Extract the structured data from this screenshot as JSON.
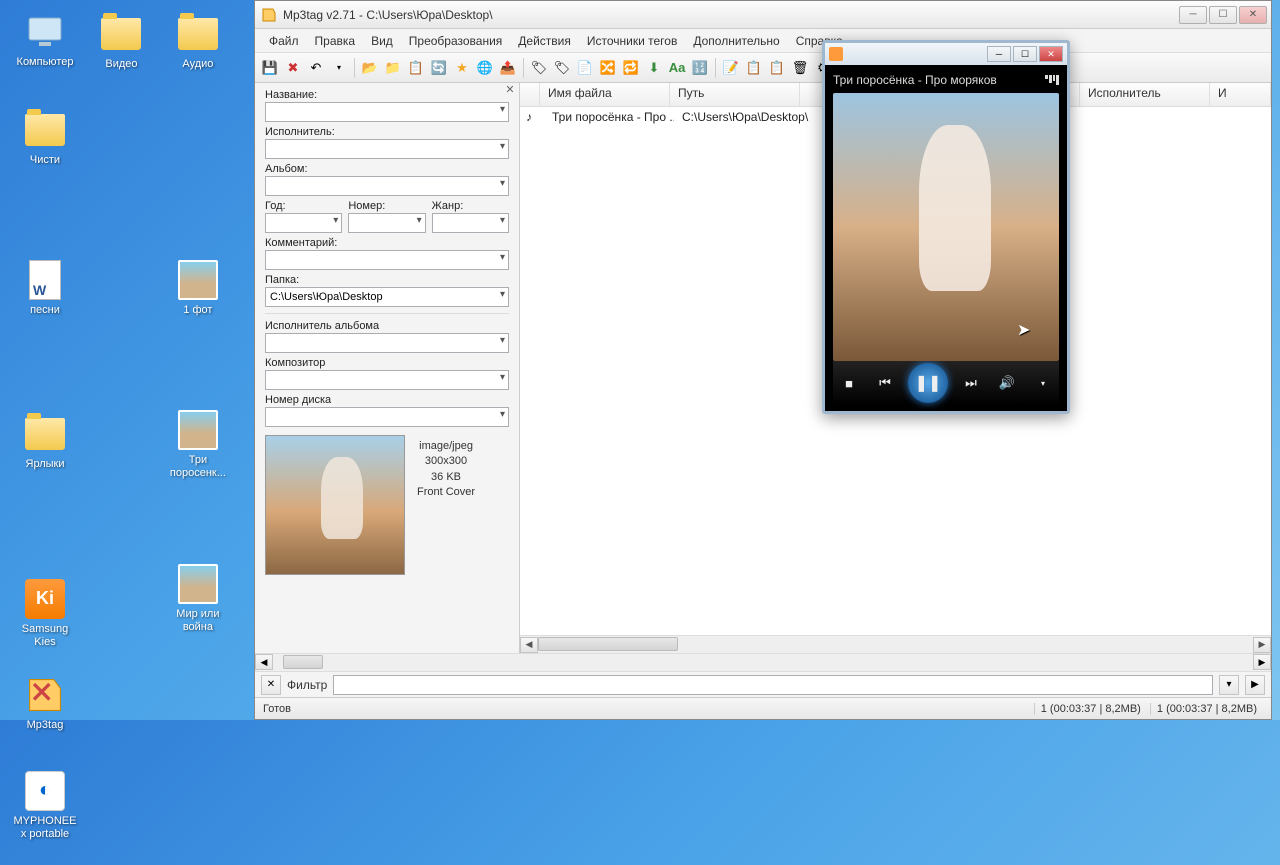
{
  "desktop": {
    "icons": [
      {
        "label": "Компьютер",
        "type": "computer"
      },
      {
        "label": "Видео",
        "type": "folder"
      },
      {
        "label": "Аудио",
        "type": "folder"
      },
      {
        "label": "Чисти",
        "type": "folder"
      },
      {
        "label": "песни",
        "type": "doc"
      },
      {
        "label": "1 фот",
        "type": "thumb"
      },
      {
        "label": "Ярлыки",
        "type": "folder"
      },
      {
        "label": "Три поросенк...",
        "type": "thumb"
      },
      {
        "label": "Samsung Kies",
        "type": "kies"
      },
      {
        "label": "Мир или война",
        "type": "thumb"
      },
      {
        "label": "Mp3tag",
        "type": "mp3tag"
      },
      {
        "label": "MYPHONEEx portable",
        "type": "myphone"
      }
    ]
  },
  "window": {
    "title": "Mp3tag v2.71  -  C:\\Users\\Юра\\Desktop\\",
    "menu": [
      "Файл",
      "Правка",
      "Вид",
      "Преобразования",
      "Действия",
      "Источники тегов",
      "Дополнительно",
      "Справка"
    ]
  },
  "tag": {
    "labels": {
      "title": "Название:",
      "artist": "Исполнитель:",
      "album": "Альбом:",
      "year": "Год:",
      "track": "Номер:",
      "genre": "Жанр:",
      "comment": "Комментарий:",
      "folder": "Папка:",
      "albumartist": "Исполнитель альбома",
      "composer": "Композитор",
      "disc": "Номер диска"
    },
    "values": {
      "title": "",
      "artist": "",
      "album": "",
      "year": "",
      "track": "",
      "genre": "",
      "comment": "",
      "folder": "C:\\Users\\Юра\\Desktop",
      "albumartist": "",
      "composer": "",
      "disc": ""
    },
    "cover": {
      "mime": "image/jpeg",
      "dims": "300x300",
      "size": "36 KB",
      "type": "Front Cover"
    }
  },
  "filelist": {
    "cols": {
      "name": "Имя файла",
      "path": "Путь",
      "artist": "Исполнитель",
      "i": "И"
    },
    "rows": [
      {
        "name": "Три поросёнка - Про ...",
        "path": "C:\\Users\\Юра\\Desktop\\"
      }
    ]
  },
  "filter": {
    "label": "Фильтр",
    "value": ""
  },
  "status": {
    "left": "Готов",
    "right1": "1 (00:03:37 | 8,2MB)",
    "right2": "1 (00:03:37 | 8,2MB)"
  },
  "player": {
    "track": "Три поросёнка - Про моряков"
  }
}
